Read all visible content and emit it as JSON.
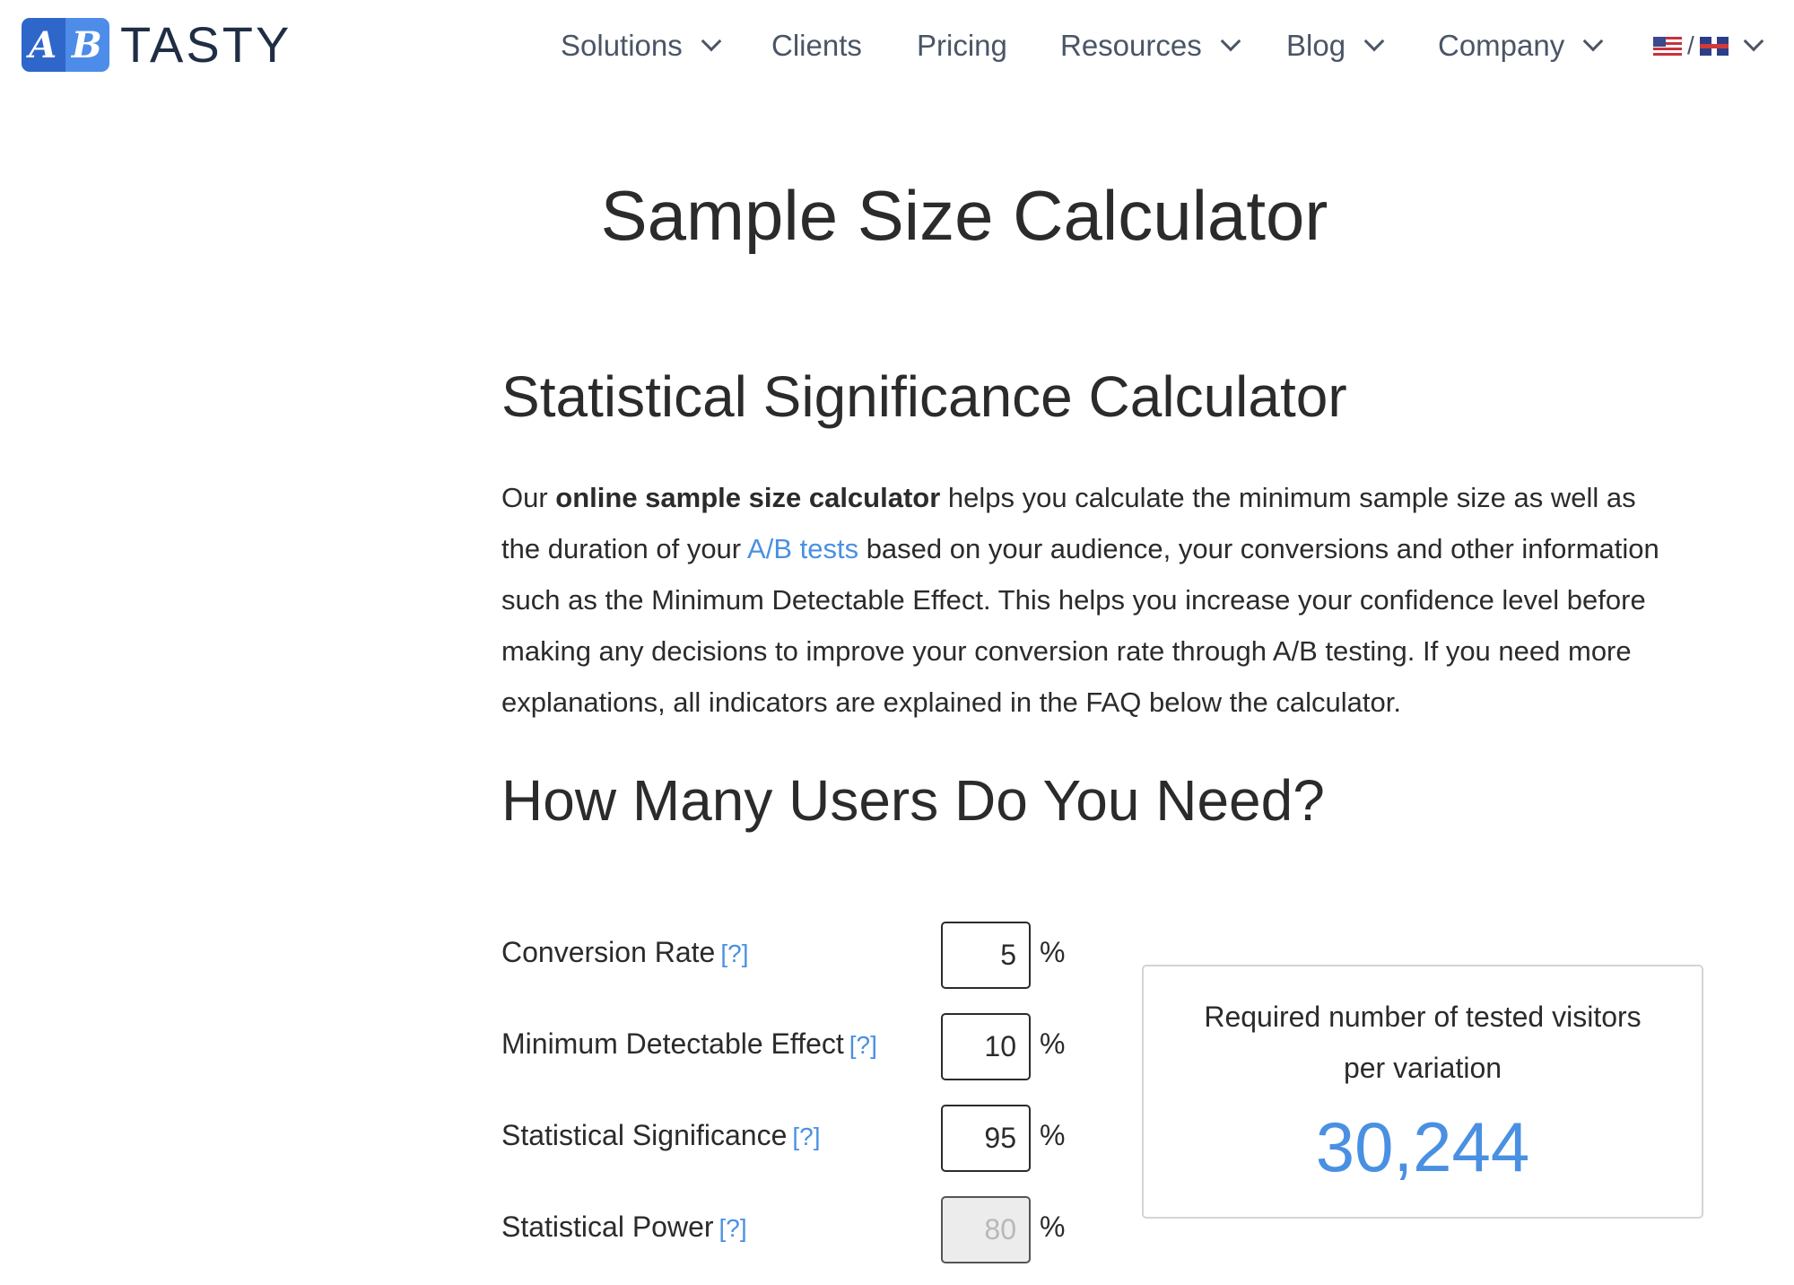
{
  "brand": {
    "badge_left": "A",
    "badge_right": "B",
    "wordmark": "TASTY"
  },
  "nav": {
    "items": [
      {
        "label": "Solutions",
        "dropdown": true
      },
      {
        "label": "Clients",
        "dropdown": false
      },
      {
        "label": "Pricing",
        "dropdown": false
      },
      {
        "label": "Resources",
        "dropdown": true
      },
      {
        "label": "Blog",
        "dropdown": true
      },
      {
        "label": "Company",
        "dropdown": true
      }
    ],
    "language": {
      "flags": [
        "us-flag",
        "uk-flag"
      ],
      "separator": "/"
    }
  },
  "page_title": "Sample Size Calculator",
  "section_title": "Statistical Significance Calculator",
  "intro": {
    "t1": "Our ",
    "bold": "online sample size calculator",
    "t2": " helps you calculate the minimum sample size as well as the duration of your ",
    "link": "A/B tests",
    "t3": " based on your audience, your conversions and other information such as the Minimum Detectable Effect. This helps you increase your confidence level before making any decisions to improve your conversion rate through A/B testing. If you need more explanations, all indicators are explained in the FAQ below the calculator."
  },
  "calculator": {
    "title": "How Many Users Do You Need?",
    "help_text": "[?]",
    "unit": "%",
    "fields": [
      {
        "label": "Conversion Rate",
        "value": "5",
        "disabled": false
      },
      {
        "label": "Minimum Detectable Effect",
        "value": "10",
        "disabled": false
      },
      {
        "label": "Statistical Significance",
        "value": "95",
        "disabled": false
      },
      {
        "label": "Statistical Power",
        "value": "80",
        "disabled": true
      }
    ],
    "result": {
      "label": "Required number of tested visitors per variation",
      "value": "30,244"
    }
  },
  "colors": {
    "accent": "#4a90e2",
    "brand_dark": "#1f2e45",
    "brand_blue": "#2f66c9"
  }
}
